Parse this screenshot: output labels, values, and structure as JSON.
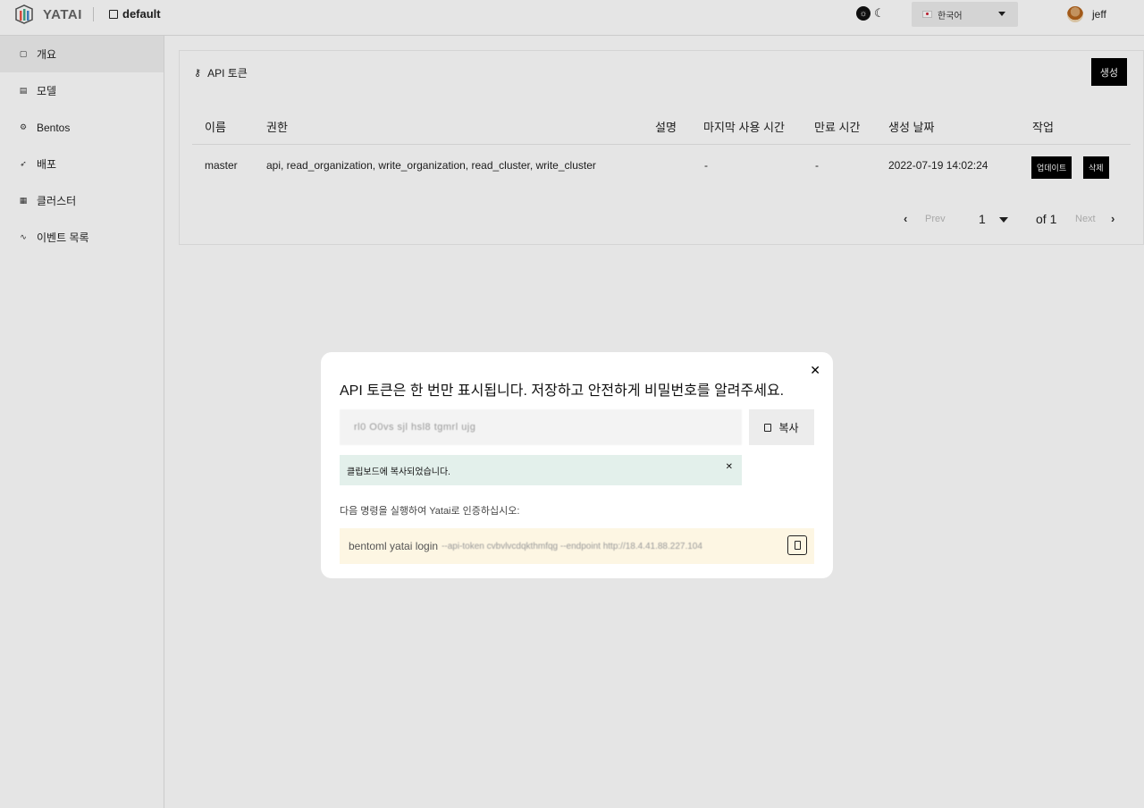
{
  "header": {
    "brand": "YATAI",
    "org": "default",
    "language": "한국어",
    "user": "jeff"
  },
  "sidebar": {
    "items": [
      {
        "label": "개요",
        "icon": "overview-icon"
      },
      {
        "label": "모델",
        "icon": "model-icon"
      },
      {
        "label": "Bentos",
        "icon": "bentos-icon"
      },
      {
        "label": "배포",
        "icon": "rocket-icon"
      },
      {
        "label": "클러스터",
        "icon": "cluster-icon"
      },
      {
        "label": "이벤트 목록",
        "icon": "activity-icon"
      }
    ]
  },
  "card": {
    "title": "API 토큰",
    "create_label": "생성",
    "columns": [
      "이름",
      "권한",
      "설명",
      "마지막 사용 시간",
      "만료 시간",
      "생성 날짜",
      "작업"
    ],
    "rows": [
      {
        "name": "master",
        "scopes": "api, read_organization, write_organization, read_cluster, write_cluster",
        "description": "",
        "last_used": "-",
        "expires": "-",
        "created": "2022-07-19 14:02:24",
        "update_label": "업데이트",
        "delete_label": "삭제"
      }
    ],
    "pager": {
      "prev": "Prev",
      "page": "1",
      "of": "of 1",
      "next": "Next"
    }
  },
  "modal": {
    "title": "API 토큰은 한 번만 표시됩니다. 저장하고 안전하게 비밀번호를 알려주세요.",
    "token_masked": "rl0 O0vs sjl hsl8 tgmrl ujg",
    "copy_label": "복사",
    "notice": "클립보드에 복사되었습니다.",
    "instruction": "다음 명령을 실행하여 Yatai로 인증하십시오:",
    "command": "bentoml yatai login",
    "command_masked": "--api-token cvbvlvcdqkthmfqg --endpoint http://18.4.41.88.227.104"
  }
}
